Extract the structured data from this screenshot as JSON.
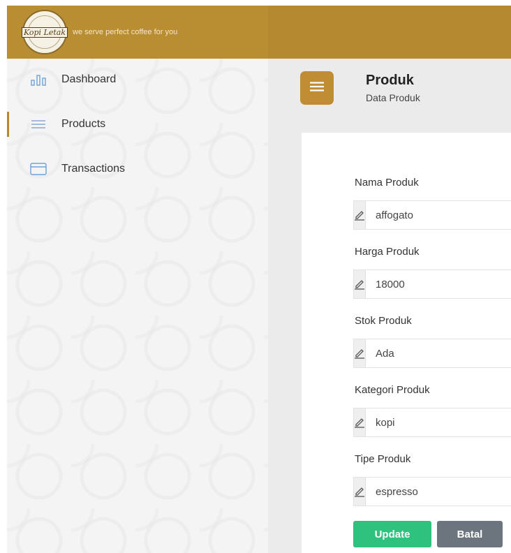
{
  "brand": {
    "logo_text": "Kopi Letak",
    "tagline": "we serve perfect coffee for you"
  },
  "sidebar": {
    "items": [
      {
        "label": "Dashboard",
        "icon": "bar-chart-icon",
        "active": false
      },
      {
        "label": "Products",
        "icon": "menu-lines-icon",
        "active": true
      },
      {
        "label": "Transactions",
        "icon": "card-icon",
        "active": false
      }
    ]
  },
  "header": {
    "title": "Produk",
    "subtitle": "Data Produk"
  },
  "form": {
    "fields": [
      {
        "label": "Nama Produk",
        "value": "affogato",
        "icon": "pencil-icon"
      },
      {
        "label": "Harga Produk",
        "value": "18000",
        "icon": "pencil-icon"
      },
      {
        "label": "Stok Produk",
        "value": "Ada",
        "icon": "pencil-icon"
      },
      {
        "label": "Kategori Produk",
        "value": "kopi",
        "icon": "pencil-icon"
      },
      {
        "label": "Tipe Produk",
        "value": "espresso",
        "icon": "pencil-icon"
      }
    ],
    "update_label": "Update",
    "cancel_label": "Batal"
  },
  "colors": {
    "brand": "#b4892f",
    "menu_button": "#c08d34",
    "update_button": "#2ec27e",
    "cancel_button": "#6c757d"
  }
}
